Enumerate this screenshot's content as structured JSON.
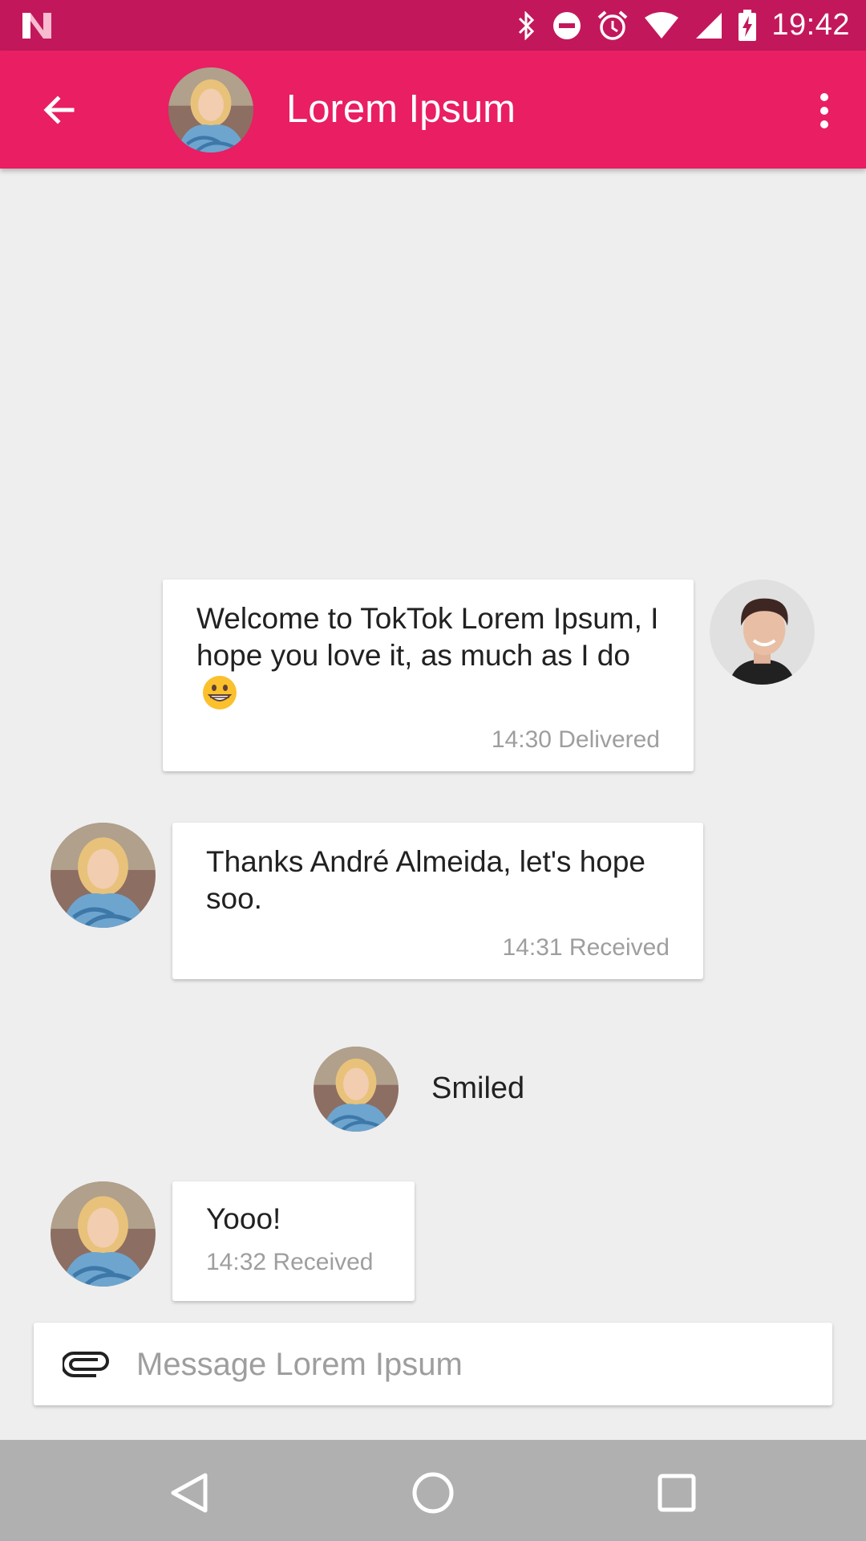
{
  "status_bar": {
    "time": "19:42",
    "icons": [
      "n-logo",
      "bluetooth-icon",
      "do-not-disturb-icon",
      "alarm-icon",
      "wifi-icon",
      "cell-signal-icon",
      "battery-charging-icon"
    ]
  },
  "header": {
    "title": "Lorem Ipsum",
    "back_icon": "arrow-back-icon",
    "menu_icon": "more-vert-icon"
  },
  "messages": [
    {
      "side": "sent",
      "text": "Welcome to TokTok Lorem Ipsum, I hope you love it, as much as I do",
      "emoji": "grinning-face",
      "meta": "14:30 Delivered"
    },
    {
      "side": "received",
      "text": "Thanks André Almeida, let's hope soo.",
      "meta": "14:31 Received"
    },
    {
      "side": "event",
      "text": "Smiled"
    },
    {
      "side": "received",
      "text": "Yooo!",
      "meta": "14:32 Received"
    }
  ],
  "composer": {
    "placeholder": "Message Lorem Ipsum",
    "value": "",
    "attach_icon": "paperclip-icon"
  },
  "colors": {
    "status_bar": "#c2185b",
    "app_bar": "#e91e63",
    "background": "#eeeeee",
    "nav_bar": "#b0b0b0"
  }
}
